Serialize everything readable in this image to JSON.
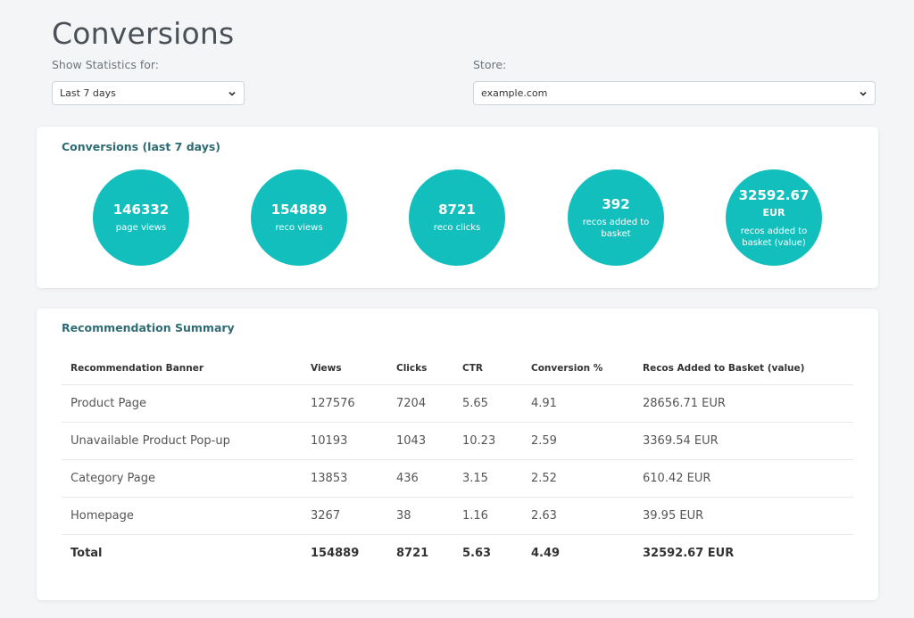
{
  "page": {
    "title": "Conversions"
  },
  "filters": {
    "period_label": "Show Statistics for:",
    "period_value": "Last 7 days",
    "store_label": "Store:",
    "store_value": "example.com"
  },
  "colors": {
    "accent": "#13bfbd",
    "heading": "#2f6b73"
  },
  "conversions": {
    "title": "Conversions (last 7 days)",
    "stats": [
      {
        "value": "146332",
        "unit": "",
        "label": "page views"
      },
      {
        "value": "154889",
        "unit": "",
        "label": "reco views"
      },
      {
        "value": "8721",
        "unit": "",
        "label": "reco clicks"
      },
      {
        "value": "392",
        "unit": "",
        "label": "recos added to basket"
      },
      {
        "value": "32592.67",
        "unit": "EUR",
        "label": "recos added to basket (value)"
      }
    ]
  },
  "summary": {
    "title": "Recommendation Summary",
    "columns": [
      "Recommendation Banner",
      "Views",
      "Clicks",
      "CTR",
      "Conversion %",
      "Recos Added to Basket (value)"
    ],
    "rows": [
      [
        "Product Page",
        "127576",
        "7204",
        "5.65",
        "4.91",
        "28656.71 EUR"
      ],
      [
        "Unavailable Product Pop-up",
        "10193",
        "1043",
        "10.23",
        "2.59",
        "3369.54 EUR"
      ],
      [
        "Category Page",
        "13853",
        "436",
        "3.15",
        "2.52",
        "610.42 EUR"
      ],
      [
        "Homepage",
        "3267",
        "38",
        "1.16",
        "2.63",
        "39.95 EUR"
      ]
    ],
    "total": [
      "Total",
      "154889",
      "8721",
      "5.63",
      "4.49",
      "32592.67 EUR"
    ]
  }
}
